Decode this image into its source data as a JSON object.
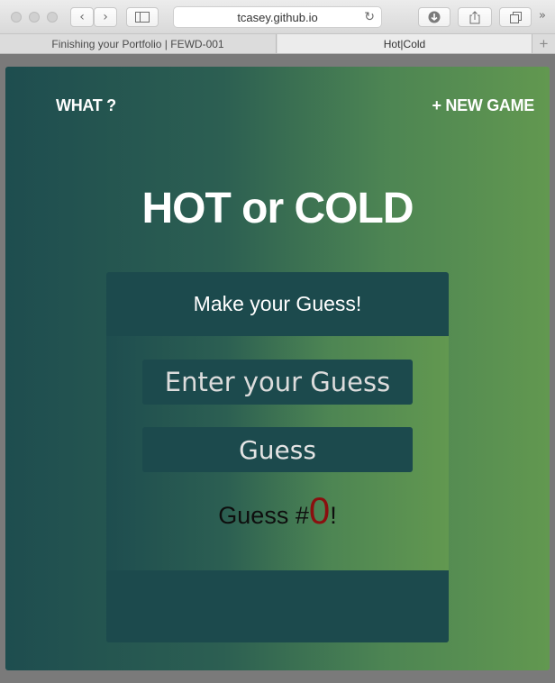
{
  "browser": {
    "address": "tcasey.github.io",
    "tabs": [
      {
        "label": "Finishing your Portfolio | FEWD-001"
      },
      {
        "label": "Hot|Cold"
      }
    ],
    "add_tab": "+"
  },
  "nav": {
    "what_label": "WHAT ?",
    "new_game_label": "+ NEW GAME"
  },
  "title": "HOT or COLD",
  "game": {
    "header": "Make your Guess!",
    "input_placeholder": "Enter your Guess",
    "input_value": "",
    "guess_button": "Guess",
    "count_prefix": "Guess #",
    "count": "0",
    "count_suffix": "!"
  },
  "colors": {
    "gradient_left": "#1e4d4f",
    "gradient_right": "#629850",
    "card": "#1c4a4d",
    "count_number": "#8a0f0f"
  }
}
